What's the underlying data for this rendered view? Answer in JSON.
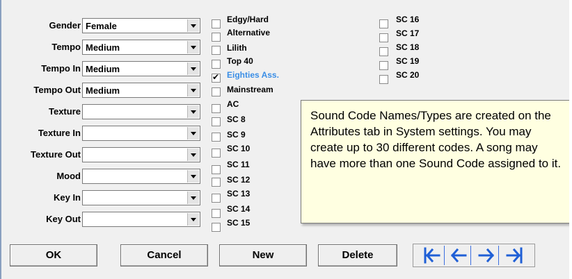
{
  "fields": [
    {
      "label": "Gender",
      "value": "Female"
    },
    {
      "label": "Tempo",
      "value": "Medium"
    },
    {
      "label": "Tempo In",
      "value": "Medium"
    },
    {
      "label": "Tempo Out",
      "value": "Medium"
    },
    {
      "label": "Texture",
      "value": ""
    },
    {
      "label": "Texture In",
      "value": ""
    },
    {
      "label": "Texture Out",
      "value": ""
    },
    {
      "label": "Mood",
      "value": ""
    },
    {
      "label": "Key In",
      "value": ""
    },
    {
      "label": "Key Out",
      "value": ""
    }
  ],
  "sound_codes_col1": [
    {
      "label": "Edgy/Hard",
      "checked": false
    },
    {
      "label": "Alternative",
      "checked": false
    },
    {
      "label": "Lilith",
      "checked": false
    },
    {
      "label": "Top 40",
      "checked": false
    },
    {
      "label": "Eighties Ass.",
      "checked": true
    },
    {
      "label": "Mainstream",
      "checked": false
    },
    {
      "label": "AC",
      "checked": false
    },
    {
      "label": "SC 8",
      "checked": false
    },
    {
      "label": "SC 9",
      "checked": false
    },
    {
      "label": "SC 10",
      "checked": false
    },
    {
      "label": "SC 11",
      "checked": false
    },
    {
      "label": "SC 12",
      "checked": false
    },
    {
      "label": "SC 13",
      "checked": false
    },
    {
      "label": "SC 14",
      "checked": false
    },
    {
      "label": "SC 15",
      "checked": false
    }
  ],
  "sound_codes_col2": [
    {
      "label": "SC 16",
      "checked": false
    },
    {
      "label": "SC 17",
      "checked": false
    },
    {
      "label": "SC 18",
      "checked": false
    },
    {
      "label": "SC 19",
      "checked": false
    },
    {
      "label": "SC 20",
      "checked": false
    }
  ],
  "tooltip": {
    "text": "Sound Code Names/Types are created on the Attributes tab in System settings.  You may create up to 30 different codes.  A song may have more than one Sound Code assigned to it."
  },
  "buttons": {
    "ok": "OK",
    "cancel": "Cancel",
    "new": "New",
    "delete": "Delete"
  },
  "navigation": {
    "icons": [
      "first-record-icon",
      "previous-record-icon",
      "next-record-icon",
      "last-record-icon"
    ],
    "color": "#1f5fd6"
  }
}
